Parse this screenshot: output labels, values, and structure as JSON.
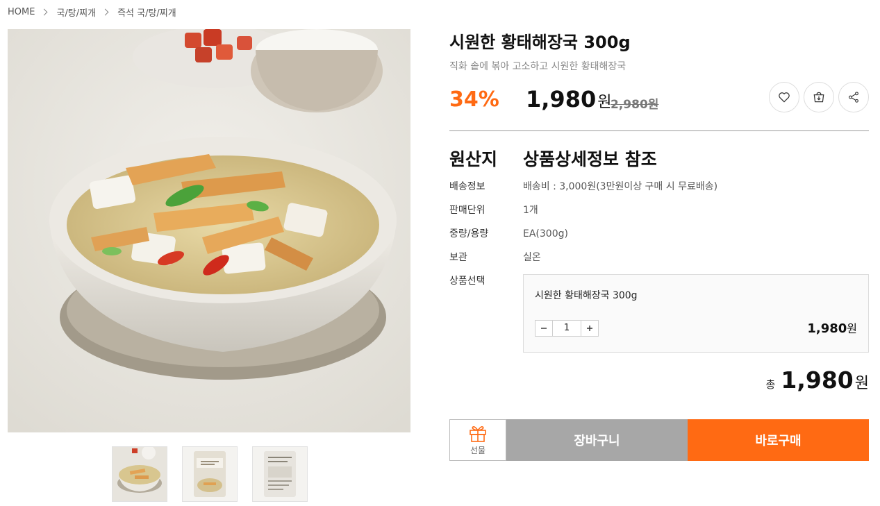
{
  "breadcrumb": [
    "HOME",
    "국/탕/찌개",
    "즉석 국/탕/찌개"
  ],
  "product": {
    "title": "시원한 황태해장국 300g",
    "subtitle": "직화 솥에 볶아 고소하고 시원한 황태해장국",
    "discount": "34%",
    "price": "1,980",
    "price_unit": "원",
    "original_price": "2,980원"
  },
  "icons": [
    "heart-icon",
    "cart-download-icon",
    "share-icon"
  ],
  "origin": {
    "label": "원산지",
    "value": "상품상세정보 참조"
  },
  "specs": [
    {
      "label": "배송정보",
      "value": "배송비 : 3,000원(3만원이상 구매 시 무료배송)"
    },
    {
      "label": "판매단위",
      "value": "1개"
    },
    {
      "label": "중량/용량",
      "value": "EA(300g)"
    },
    {
      "label": "보관",
      "value": "실온"
    }
  ],
  "option": {
    "label": "상품선택",
    "name": "시원한 황태해장국 300g",
    "quantity": "1",
    "price": "1,980",
    "price_unit": "원"
  },
  "total": {
    "label": "총",
    "price": "1,980",
    "unit": "원"
  },
  "buttons": {
    "gift": "선물",
    "cart": "장바구니",
    "buy": "바로구매"
  },
  "colors": {
    "accent": "#ff6a13",
    "cart_button": "#a7a7a7"
  }
}
